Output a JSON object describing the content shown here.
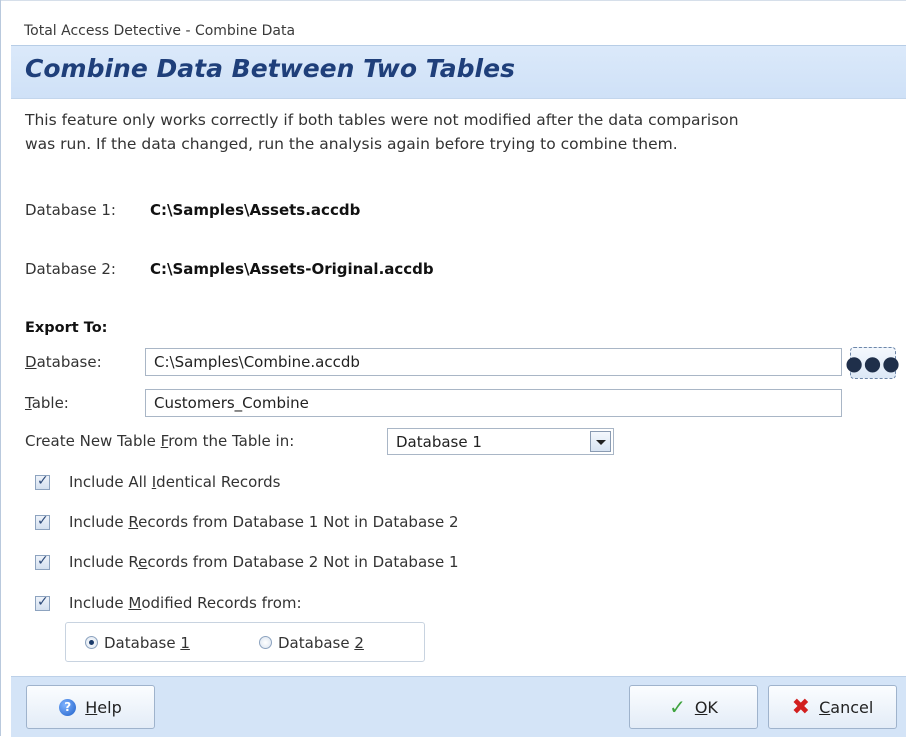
{
  "window": {
    "title": "Total Access Detective - Combine Data"
  },
  "header": {
    "heading": "Combine Data Between Two Tables"
  },
  "description": {
    "line1": "This feature only works correctly if both tables were not modified after the data comparison",
    "line2": "was run. If the data changed, run the analysis again before trying to combine them."
  },
  "databases": [
    {
      "label": "Database 1:",
      "path": "C:\\Samples\\Assets.accdb"
    },
    {
      "label": "Database 2:",
      "path": "C:\\Samples\\Assets-Original.accdb"
    }
  ],
  "export": {
    "section_label": "Export To:",
    "database_label_key": "D",
    "database_label_rest": "atabase:",
    "database_value": "C:\\Samples\\Combine.accdb",
    "table_label_key": "T",
    "table_label_rest": "able:",
    "table_value": "Customers_Combine",
    "browse_icon": "ellipsis-icon"
  },
  "create_from": {
    "label_pre": "Create New Table ",
    "label_key": "F",
    "label_post": "rom the Table in:",
    "selected": "Database 1"
  },
  "options": [
    {
      "pre": "Include All ",
      "key": "I",
      "post": "dentical Records",
      "checked": true
    },
    {
      "pre": "Include ",
      "key": "R",
      "post": "ecords from Database 1 Not in Database 2",
      "checked": true
    },
    {
      "pre": "Include R",
      "key": "e",
      "post": "cords from Database 2 Not in Database 1",
      "checked": true
    },
    {
      "pre": "Include ",
      "key": "M",
      "post": "odified Records from:",
      "checked": true
    }
  ],
  "modified_source": {
    "options": [
      {
        "pre": "Database ",
        "key": "1",
        "selected": true
      },
      {
        "pre": "Database ",
        "key": "2",
        "selected": false
      }
    ]
  },
  "footer": {
    "help": {
      "key": "H",
      "rest": "elp",
      "icon": "help-icon"
    },
    "ok": {
      "key": "O",
      "rest": "K",
      "icon": "checkmark-icon"
    },
    "cancel": {
      "key": "C",
      "rest": "ancel",
      "icon": "x-icon"
    }
  }
}
